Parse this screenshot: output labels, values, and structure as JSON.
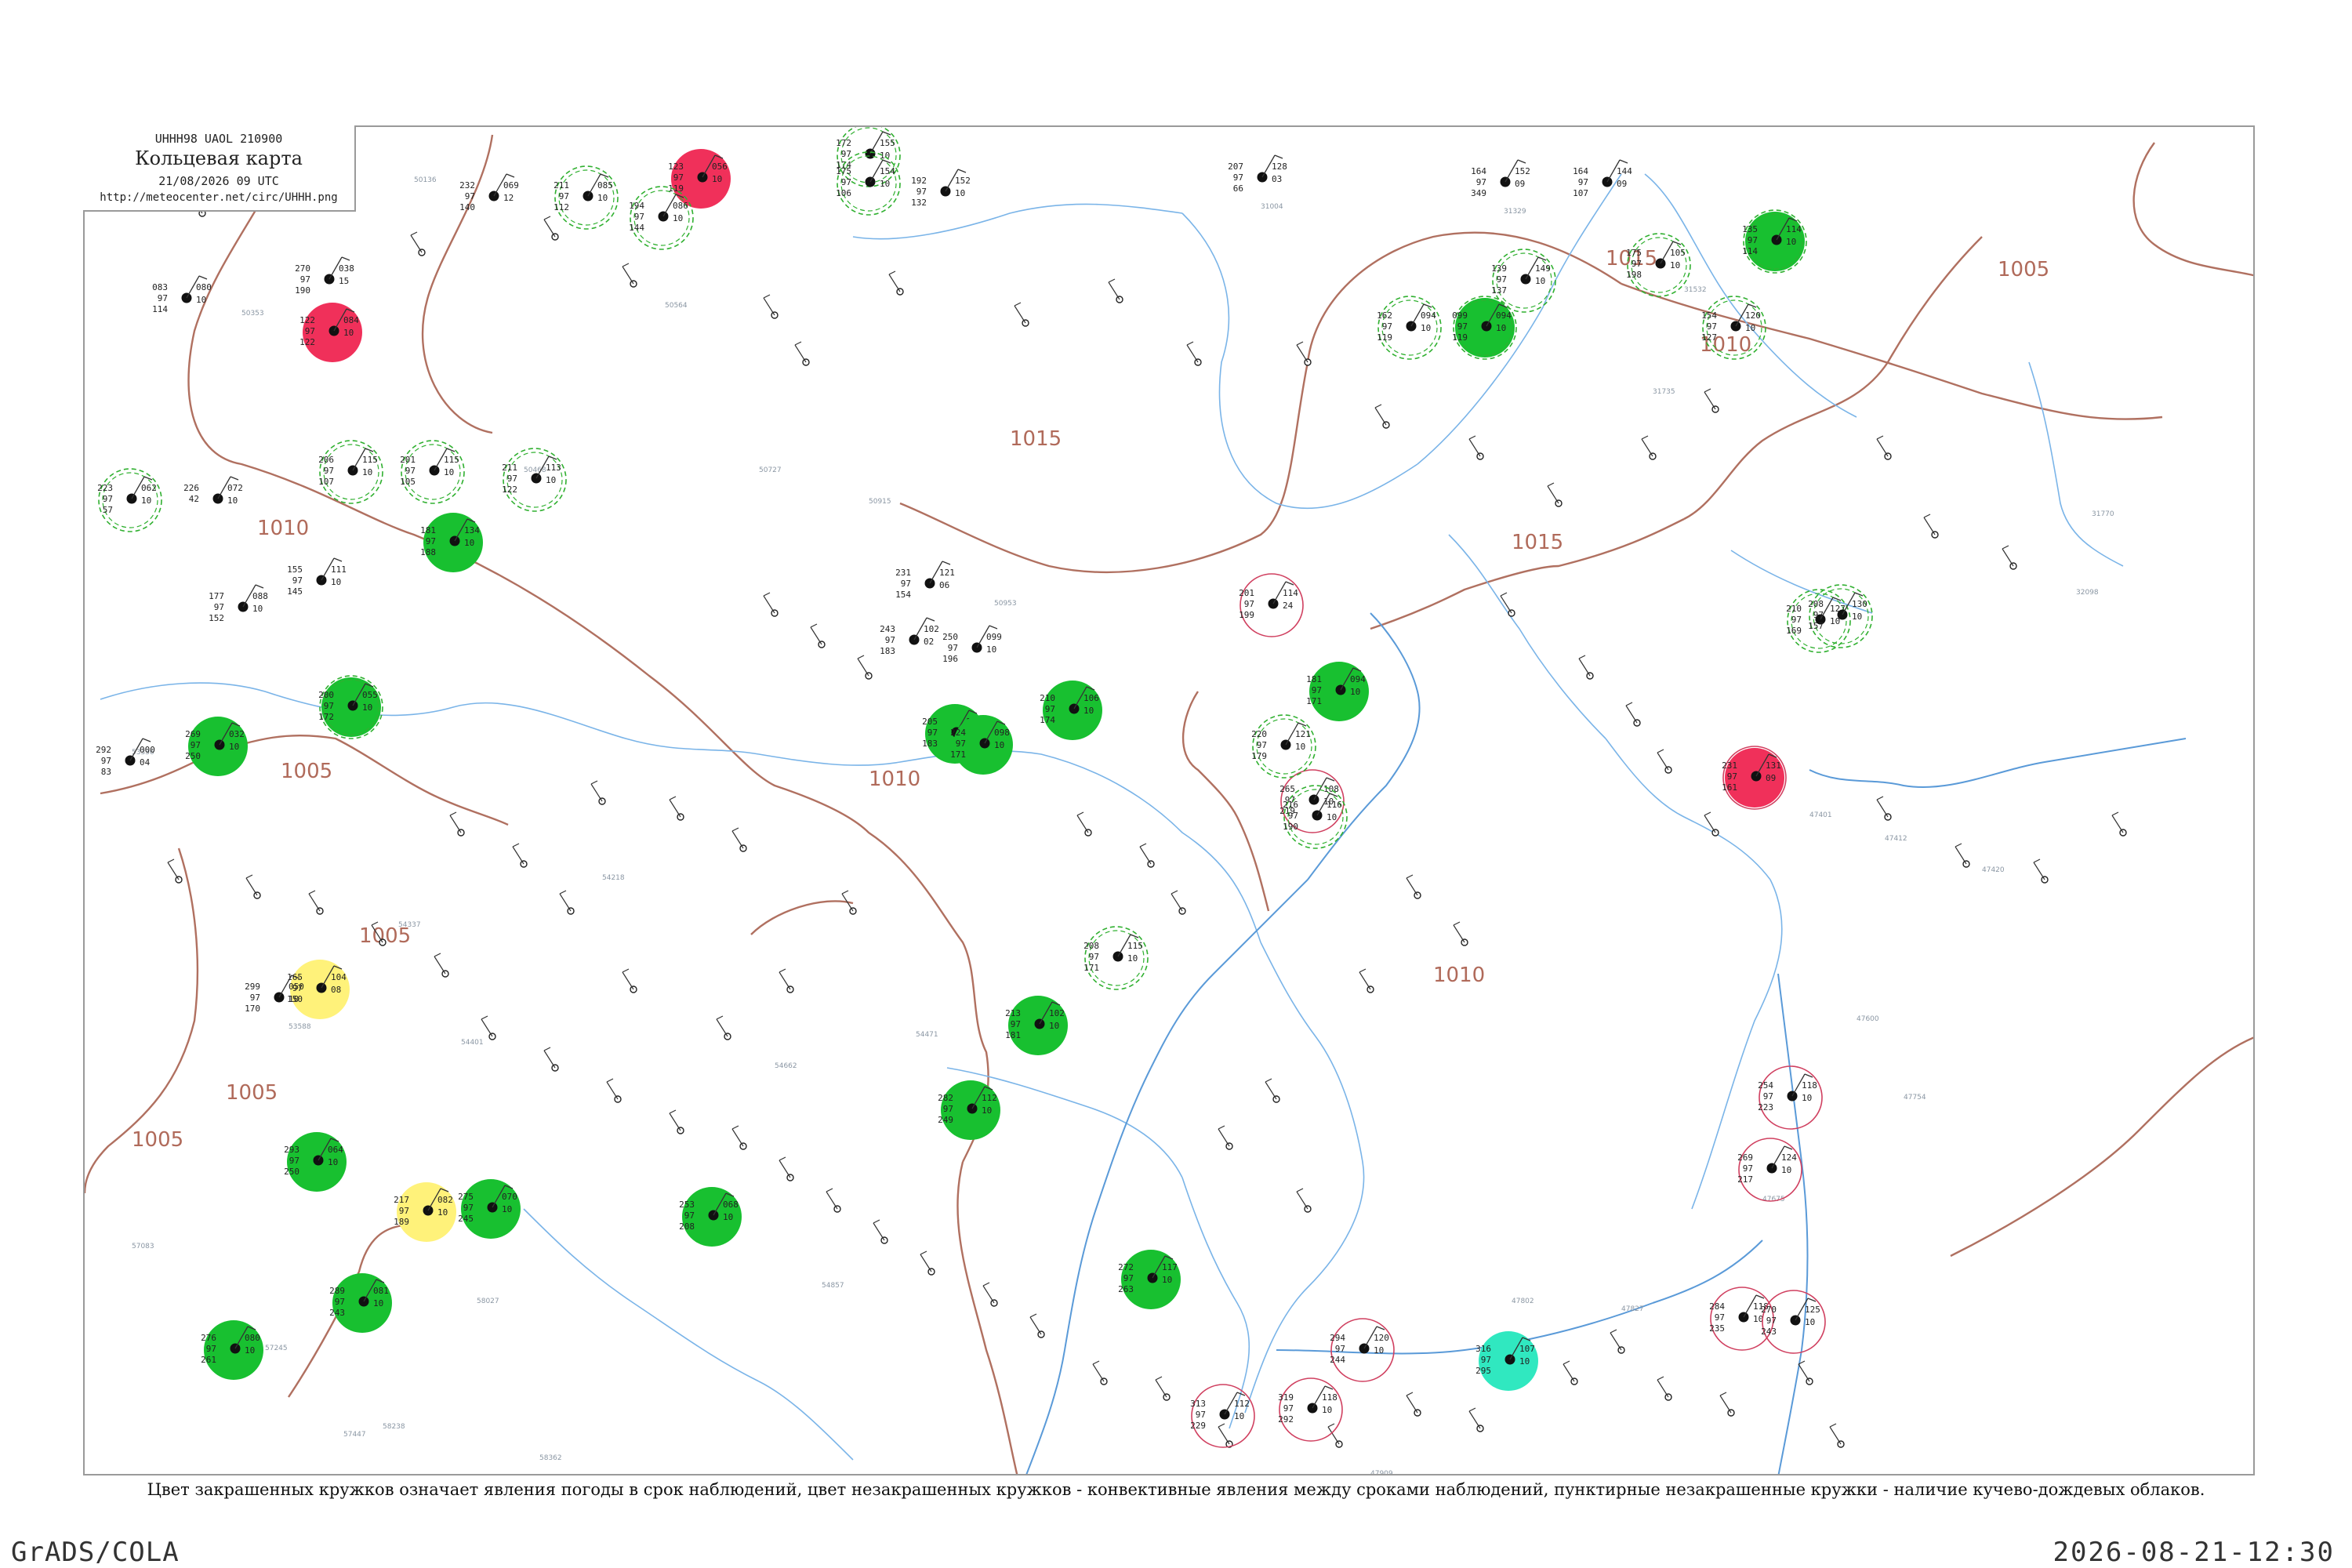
{
  "header": {
    "code": "UHHH98  UAOL  210900",
    "title": "Кольцевая карта",
    "date": "21/08/2026 09 UTC",
    "url": "http://meteocenter.net/circ/UHHH.png"
  },
  "caption": "Цвет закрашенных кружков означает явления погоды в срок наблюдений, цвет незакрашенных кружков - конвективные явления между сроками наблюдений, пунктирные незакрашенные кружки - наличие кучево-дождевых облаков.",
  "footer": {
    "left": "GrADS/COLA",
    "right": "2026-08-21-12:30"
  },
  "colors": {
    "isobar": "#b07060",
    "river": "#7ab4e8",
    "coast": "#5a9ad8",
    "red_fill": "#f0305a",
    "green_fill": "#18c030",
    "yellow_fill": "#fff27a",
    "cyan_fill": "#30e8c0",
    "green_dash": "#30b030",
    "red_ring": "#d04060",
    "wind": "#333333"
  },
  "isobar_labels": [
    "1015",
    "1015",
    "1015",
    "1010",
    "1010",
    "1010",
    "1010",
    "1005",
    "1005",
    "1005",
    "1005",
    "1005"
  ],
  "station_id_labels": [
    "31004",
    "31329",
    "31532",
    "31735",
    "31770",
    "32098",
    "47401",
    "47412",
    "47420",
    "47600",
    "47675",
    "47754",
    "47802",
    "47827",
    "47909",
    "50136",
    "50353",
    "50468",
    "50564",
    "50727",
    "50915",
    "50953",
    "53336",
    "53588",
    "54218",
    "54337",
    "54401",
    "54471",
    "54662",
    "54857",
    "57083",
    "57245",
    "57447",
    "58027",
    "58238",
    "58362"
  ],
  "stations": [
    {
      "p": "211",
      "t": "97",
      "d": "112",
      "pr": "085",
      "n": "10",
      "fill": "none",
      "ring": "green-dash"
    },
    {
      "p": "123",
      "t": "97",
      "d": "119",
      "pr": "056",
      "n": "10",
      "fill": "red",
      "ring": "none"
    },
    {
      "p": "172",
      "t": "97",
      "d": "174",
      "pr": "155",
      "n": "10",
      "fill": "none",
      "ring": "green-dash"
    },
    {
      "p": "175",
      "t": "97",
      "d": "106",
      "pr": "154",
      "n": "10",
      "fill": "none",
      "ring": "green-dash"
    },
    {
      "p": "192",
      "t": "97",
      "d": "132",
      "pr": "152",
      "n": "10",
      "fill": "none",
      "ring": "none"
    },
    {
      "p": "207",
      "t": "97",
      "d": "66",
      "pr": "128",
      "n": "03",
      "fill": "none",
      "ring": "none"
    },
    {
      "p": "164",
      "t": "97",
      "d": "349",
      "pr": "152",
      "n": "09",
      "fill": "none",
      "ring": "none"
    },
    {
      "p": "164",
      "t": "97",
      "d": "107",
      "pr": "144",
      "n": "09",
      "fill": "none",
      "ring": "none"
    },
    {
      "p": "135",
      "t": "97",
      "d": "114",
      "pr": "114",
      "n": "10",
      "fill": "green",
      "ring": "green-dash"
    },
    {
      "p": "232",
      "t": "97",
      "d": "140",
      "pr": "069",
      "n": "12",
      "fill": "none",
      "ring": "none"
    },
    {
      "p": "194",
      "t": "97",
      "d": "144",
      "pr": "086",
      "n": "10",
      "fill": "none",
      "ring": "green-dash"
    },
    {
      "p": "175",
      "t": "97",
      "d": "198",
      "pr": "105",
      "n": "10",
      "fill": "none",
      "ring": "green-dash"
    },
    {
      "p": "139",
      "t": "97",
      "d": "137",
      "pr": "149",
      "n": "10",
      "fill": "none",
      "ring": "green-dash"
    },
    {
      "p": "099",
      "t": "97",
      "d": "119",
      "pr": "094",
      "n": "10",
      "fill": "green",
      "ring": "green-dash"
    },
    {
      "p": "154",
      "t": "97",
      "d": "127",
      "pr": "120",
      "n": "10",
      "fill": "none",
      "ring": "green-dash"
    },
    {
      "p": "083",
      "t": "97",
      "d": "114",
      "pr": "080",
      "n": "10",
      "fill": "none",
      "ring": "none"
    },
    {
      "p": "270",
      "t": "97",
      "d": "190",
      "pr": "038",
      "n": "15",
      "fill": "none",
      "ring": "none"
    },
    {
      "p": "122",
      "t": "97",
      "d": "122",
      "pr": "084",
      "n": "10",
      "fill": "red",
      "ring": "none"
    },
    {
      "p": "162",
      "t": "97",
      "d": "119",
      "pr": "094",
      "n": "10",
      "fill": "none",
      "ring": "green-dash"
    },
    {
      "p": "206",
      "t": "97",
      "d": "107",
      "pr": "115",
      "n": "10",
      "fill": "none",
      "ring": "green-dash"
    },
    {
      "p": "201",
      "t": "97",
      "d": "105",
      "pr": "115",
      "n": "10",
      "fill": "none",
      "ring": "green-dash"
    },
    {
      "p": "211",
      "t": "97",
      "d": "122",
      "pr": "113",
      "n": "10",
      "fill": "none",
      "ring": "green-dash"
    },
    {
      "p": "223",
      "t": "97",
      "d": "57",
      "pr": "062",
      "n": "10",
      "fill": "none",
      "ring": "green-dash"
    },
    {
      "p": "226",
      "t": "42",
      "d": "",
      "pr": "072",
      "n": "10",
      "fill": "none",
      "ring": "none"
    },
    {
      "p": "181",
      "t": "97",
      "d": "188",
      "pr": "134",
      "n": "10",
      "fill": "green",
      "ring": "none"
    },
    {
      "p": "155",
      "t": "97",
      "d": "145",
      "pr": "111",
      "n": "10",
      "fill": "none",
      "ring": "none"
    },
    {
      "p": "177",
      "t": "97",
      "d": "152",
      "pr": "088",
      "n": "10",
      "fill": "none",
      "ring": "none"
    },
    {
      "p": "200",
      "t": "97",
      "d": "172",
      "pr": "055",
      "n": "10",
      "fill": "green",
      "ring": "green-dash"
    },
    {
      "p": "269",
      "t": "97",
      "d": "250",
      "pr": "032",
      "n": "10",
      "fill": "green",
      "ring": "none"
    },
    {
      "p": "292",
      "t": "97",
      "d": "83",
      "pr": "000",
      "n": "04",
      "fill": "none",
      "ring": "none"
    },
    {
      "p": "231",
      "t": "97",
      "d": "154",
      "pr": "121",
      "n": "06",
      "fill": "none",
      "ring": "none"
    },
    {
      "p": "243",
      "t": "97",
      "d": "183",
      "pr": "102",
      "n": "02",
      "fill": "none",
      "ring": "none"
    },
    {
      "p": "250",
      "t": "97",
      "d": "196",
      "pr": "099",
      "n": "10",
      "fill": "none",
      "ring": "none"
    },
    {
      "p": "205",
      "t": "97",
      "d": "183",
      "pr": "113",
      "n": "10",
      "fill": "green",
      "ring": "none"
    },
    {
      "p": "224",
      "t": "97",
      "d": "171",
      "pr": "098",
      "n": "10",
      "fill": "green",
      "ring": "none"
    },
    {
      "p": "210",
      "t": "97",
      "d": "174",
      "pr": "106",
      "n": "10",
      "fill": "green",
      "ring": "none"
    },
    {
      "p": "201",
      "t": "97",
      "d": "199",
      "pr": "114",
      "n": "24",
      "fill": "none",
      "ring": "red"
    },
    {
      "p": "181",
      "t": "97",
      "d": "171",
      "pr": "094",
      "n": "10",
      "fill": "green",
      "ring": "none"
    },
    {
      "p": "231",
      "t": "97",
      "d": "161",
      "pr": "131",
      "n": "09",
      "fill": "red",
      "ring": "red"
    },
    {
      "p": "210",
      "t": "97",
      "d": "169",
      "pr": "127",
      "n": "10",
      "fill": "none",
      "ring": "green-dash"
    },
    {
      "p": "208",
      "t": "97",
      "d": "157",
      "pr": "130",
      "n": "10",
      "fill": "none",
      "ring": "green-dash"
    },
    {
      "p": "265",
      "t": "97",
      "d": "219",
      "pr": "108",
      "n": "10",
      "fill": "none",
      "ring": "red"
    },
    {
      "p": "220",
      "t": "97",
      "d": "179",
      "pr": "121",
      "n": "10",
      "fill": "none",
      "ring": "green-dash"
    },
    {
      "p": "216",
      "t": "97",
      "d": "190",
      "pr": "116",
      "n": "10",
      "fill": "none",
      "ring": "green-dash"
    },
    {
      "p": "165",
      "t": "97",
      "d": "150",
      "pr": "104",
      "n": "08",
      "fill": "yellow",
      "ring": "none"
    },
    {
      "p": "299",
      "t": "97",
      "d": "170",
      "pr": "050",
      "n": "10",
      "fill": "none",
      "ring": "none"
    },
    {
      "p": "208",
      "t": "97",
      "d": "171",
      "pr": "115",
      "n": "10",
      "fill": "none",
      "ring": "green-dash"
    },
    {
      "p": "213",
      "t": "97",
      "d": "181",
      "pr": "102",
      "n": "10",
      "fill": "green",
      "ring": "none"
    },
    {
      "p": "282",
      "t": "97",
      "d": "249",
      "pr": "112",
      "n": "10",
      "fill": "green",
      "ring": "none"
    },
    {
      "p": "293",
      "t": "97",
      "d": "250",
      "pr": "064",
      "n": "10",
      "fill": "green",
      "ring": "none"
    },
    {
      "p": "217",
      "t": "97",
      "d": "189",
      "pr": "082",
      "n": "10",
      "fill": "yellow",
      "ring": "none"
    },
    {
      "p": "275",
      "t": "97",
      "d": "245",
      "pr": "070",
      "n": "10",
      "fill": "green",
      "ring": "none"
    },
    {
      "p": "253",
      "t": "97",
      "d": "208",
      "pr": "068",
      "n": "10",
      "fill": "green",
      "ring": "none"
    },
    {
      "p": "289",
      "t": "97",
      "d": "243",
      "pr": "081",
      "n": "10",
      "fill": "green",
      "ring": "none"
    },
    {
      "p": "276",
      "t": "97",
      "d": "261",
      "pr": "080",
      "n": "10",
      "fill": "green",
      "ring": "none"
    },
    {
      "p": "272",
      "t": "97",
      "d": "263",
      "pr": "117",
      "n": "10",
      "fill": "green",
      "ring": "none"
    },
    {
      "p": "316",
      "t": "97",
      "d": "295",
      "pr": "107",
      "n": "10",
      "fill": "cyan",
      "ring": "none"
    },
    {
      "p": "313",
      "t": "97",
      "d": "229",
      "pr": "112",
      "n": "10",
      "fill": "none",
      "ring": "red"
    },
    {
      "p": "319",
      "t": "97",
      "d": "292",
      "pr": "118",
      "n": "10",
      "fill": "none",
      "ring": "red"
    },
    {
      "p": "294",
      "t": "97",
      "d": "244",
      "pr": "120",
      "n": "10",
      "fill": "none",
      "ring": "red"
    },
    {
      "p": "284",
      "t": "97",
      "d": "235",
      "pr": "118",
      "n": "10",
      "fill": "none",
      "ring": "red"
    },
    {
      "p": "270",
      "t": "97",
      "d": "243",
      "pr": "125",
      "n": "10",
      "fill": "none",
      "ring": "red"
    },
    {
      "p": "269",
      "t": "97",
      "d": "217",
      "pr": "124",
      "n": "10",
      "fill": "none",
      "ring": "red"
    },
    {
      "p": "254",
      "t": "97",
      "d": "223",
      "pr": "118",
      "n": "10",
      "fill": "none",
      "ring": "red"
    }
  ]
}
